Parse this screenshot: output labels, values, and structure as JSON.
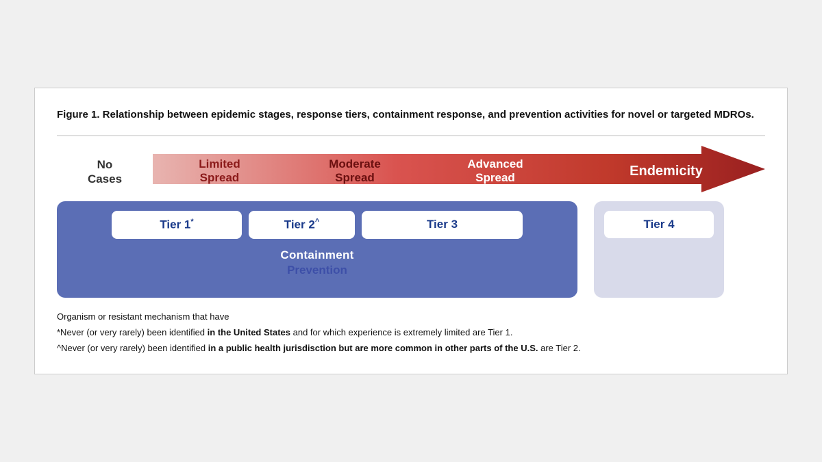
{
  "figure": {
    "title": "Figure 1. Relationship between epidemic stages, response tiers, containment response, and prevention activities for novel or targeted MDROs.",
    "stages": [
      {
        "id": "no-cases",
        "label": "No\nCases",
        "color": "#333333"
      },
      {
        "id": "limited-spread",
        "label": "Limited\nSpread",
        "color": "#c0392b"
      },
      {
        "id": "moderate-spread",
        "label": "Moderate\nSpread",
        "color": "#a93226"
      },
      {
        "id": "advanced-spread",
        "label": "Advanced\nSpread",
        "color": "#7b241c"
      },
      {
        "id": "endemicity",
        "label": "Endemicity",
        "color": "#ffffff"
      }
    ],
    "tiers": [
      {
        "id": "tier1",
        "label": "Tier 1",
        "sup": "*"
      },
      {
        "id": "tier2",
        "label": "Tier 2",
        "sup": "^"
      },
      {
        "id": "tier3",
        "label": "Tier 3",
        "sup": ""
      },
      {
        "id": "tier4",
        "label": "Tier 4",
        "sup": ""
      }
    ],
    "containment_label": "Containment",
    "prevention_label": "Prevention",
    "footnotes": {
      "line0": "Organism or resistant mechanism that have",
      "line1_pre": "*Never (or very rarely) been identified ",
      "line1_bold": "in the United States",
      "line1_post": " and for which experience is extremely limited are Tier 1.",
      "line2_pre": "^Never (or very rarely) been identified ",
      "line2_bold": "in a public health jurisdisction but are more common in other parts of the U.S.",
      "line2_post": " are Tier 2."
    }
  }
}
